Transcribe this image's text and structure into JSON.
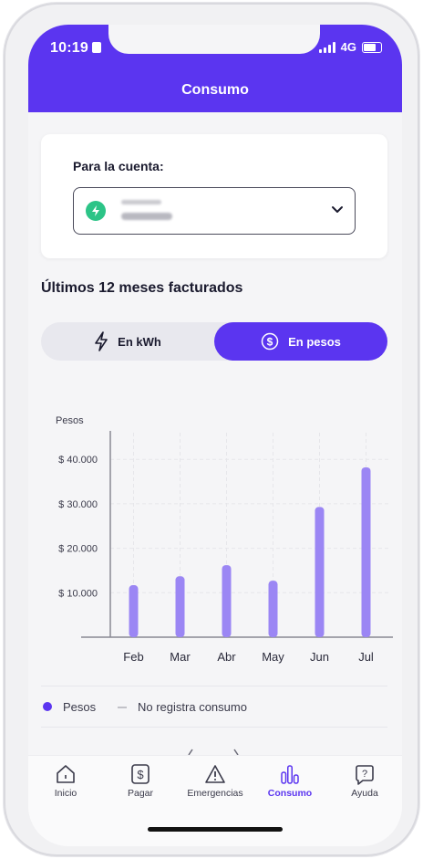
{
  "status": {
    "time": "10:19",
    "network": "4G"
  },
  "header": {
    "title": "Consumo"
  },
  "account": {
    "label": "Para la cuenta:",
    "line1": "",
    "line2": ""
  },
  "section": {
    "title": "Últimos 12 meses facturados"
  },
  "toggle": {
    "kwh_label": "En kWh",
    "pesos_label": "En pesos",
    "active": "pesos"
  },
  "chart_data": {
    "type": "bar",
    "ylabel": "Pesos",
    "categories": [
      "Feb",
      "Mar",
      "Abr",
      "May",
      "Jun",
      "Jul"
    ],
    "series": [
      {
        "name": "Pesos",
        "values": [
          11700,
          13700,
          16200,
          12700,
          29300,
          38200
        ]
      }
    ],
    "yticks": [
      10000,
      20000,
      30000,
      40000
    ],
    "ytick_labels": [
      "$ 10.000",
      "$ 20.000",
      "$ 30.000",
      "$ 40.000"
    ],
    "ylim": [
      0,
      46000
    ],
    "grid": true,
    "bar_color": "#9b86f4"
  },
  "legend": {
    "pesos": "Pesos",
    "no_consumo": "No registra consumo"
  },
  "tabs": [
    {
      "label": "Inicio",
      "icon": "home-icon"
    },
    {
      "label": "Pagar",
      "icon": "dollar-icon"
    },
    {
      "label": "Emergencias",
      "icon": "warning-icon"
    },
    {
      "label": "Consumo",
      "icon": "bar-chart-icon",
      "active": true
    },
    {
      "label": "Ayuda",
      "icon": "help-icon"
    }
  ],
  "colors": {
    "primary": "#5b35f0",
    "accent_green": "#2cc487"
  }
}
